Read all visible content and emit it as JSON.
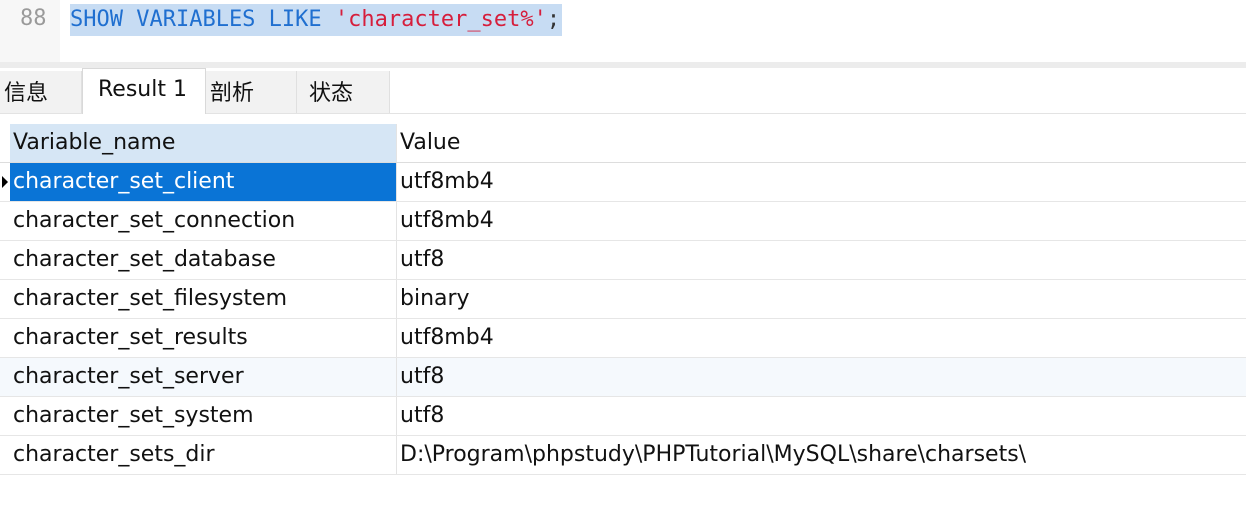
{
  "editor": {
    "line_number": "88",
    "sql_keyword": "SHOW VARIABLES LIKE ",
    "sql_string": "'character_set%'",
    "sql_terminator": ";"
  },
  "tabs": [
    {
      "label": "信息",
      "active": false
    },
    {
      "label": "Result 1",
      "active": true
    },
    {
      "label": "剖析",
      "active": false
    },
    {
      "label": "状态",
      "active": false
    }
  ],
  "result": {
    "columns": [
      "Variable_name",
      "Value"
    ],
    "rows": [
      {
        "name": "character_set_client",
        "value": "utf8mb4"
      },
      {
        "name": "character_set_connection",
        "value": "utf8mb4"
      },
      {
        "name": "character_set_database",
        "value": "utf8"
      },
      {
        "name": "character_set_filesystem",
        "value": "binary"
      },
      {
        "name": "character_set_results",
        "value": "utf8mb4"
      },
      {
        "name": "character_set_server",
        "value": "utf8"
      },
      {
        "name": "character_set_system",
        "value": "utf8"
      },
      {
        "name": "character_sets_dir",
        "value": "D:\\Program\\phpstudy\\PHPTutorial\\MySQL\\share\\charsets\\"
      }
    ],
    "selected_row": 0
  },
  "colors": {
    "keyword": "#1f6fd0",
    "string": "#d61e3c",
    "selection": "#0a74d6",
    "header_highlight": "#d6e6f5"
  }
}
